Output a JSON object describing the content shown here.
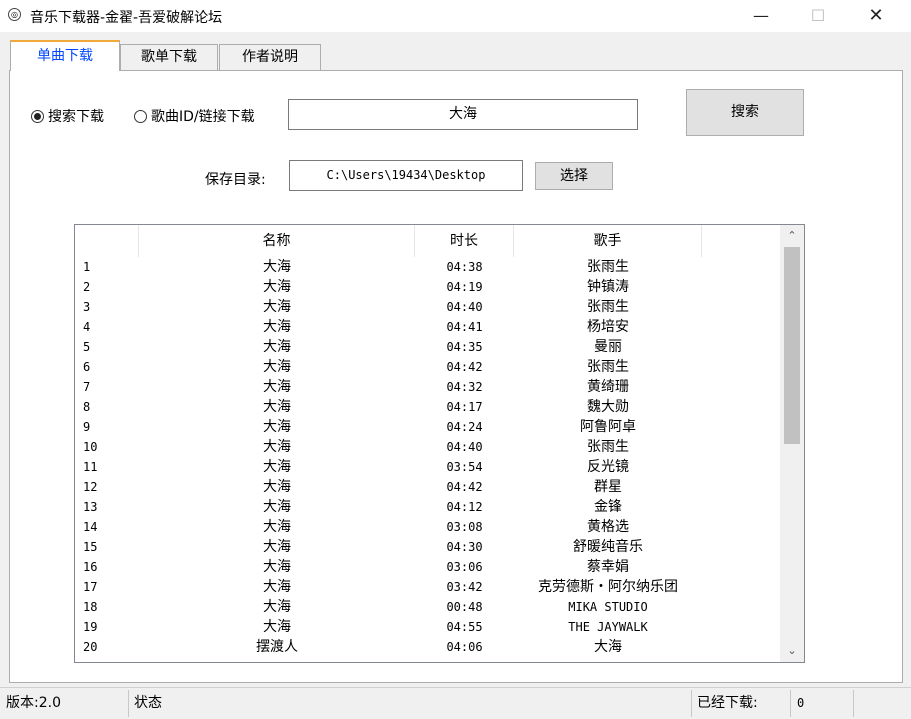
{
  "window": {
    "title": "音乐下载器-金翟-吾爱破解论坛",
    "icon_glyph": "◎"
  },
  "window_controls": {
    "minimize": "—",
    "maximize": "☐",
    "close": "✕"
  },
  "tabs": [
    {
      "label": "单曲下载",
      "active": true
    },
    {
      "label": "歌单下载",
      "active": false
    },
    {
      "label": "作者说明",
      "active": false
    }
  ],
  "mode": {
    "search_label": "搜索下载",
    "id_label": "歌曲ID/链接下载",
    "selected": "search"
  },
  "search": {
    "value": "大海",
    "button_label": "搜索"
  },
  "save": {
    "label": "保存目录:",
    "path": "C:\\Users\\19434\\Desktop",
    "choose_label": "选择"
  },
  "list": {
    "columns": [
      "名称",
      "时长",
      "歌手"
    ],
    "rows": [
      {
        "idx": "1",
        "name": "大海",
        "duration": "04:38",
        "artist": "张雨生"
      },
      {
        "idx": "2",
        "name": "大海",
        "duration": "04:19",
        "artist": "钟镇涛"
      },
      {
        "idx": "3",
        "name": "大海",
        "duration": "04:40",
        "artist": "张雨生"
      },
      {
        "idx": "4",
        "name": "大海",
        "duration": "04:41",
        "artist": "杨培安"
      },
      {
        "idx": "5",
        "name": "大海",
        "duration": "04:35",
        "artist": "曼丽"
      },
      {
        "idx": "6",
        "name": "大海",
        "duration": "04:42",
        "artist": "张雨生"
      },
      {
        "idx": "7",
        "name": "大海",
        "duration": "04:32",
        "artist": "黄绮珊"
      },
      {
        "idx": "8",
        "name": "大海",
        "duration": "04:17",
        "artist": "魏大勋"
      },
      {
        "idx": "9",
        "name": "大海",
        "duration": "04:24",
        "artist": "阿鲁阿卓"
      },
      {
        "idx": "10",
        "name": "大海",
        "duration": "04:40",
        "artist": "张雨生"
      },
      {
        "idx": "11",
        "name": "大海",
        "duration": "03:54",
        "artist": "反光镜"
      },
      {
        "idx": "12",
        "name": "大海",
        "duration": "04:42",
        "artist": "群星"
      },
      {
        "idx": "13",
        "name": "大海",
        "duration": "04:12",
        "artist": "金锋"
      },
      {
        "idx": "14",
        "name": "大海",
        "duration": "03:08",
        "artist": "黄格选"
      },
      {
        "idx": "15",
        "name": "大海",
        "duration": "04:30",
        "artist": "舒暖纯音乐"
      },
      {
        "idx": "16",
        "name": "大海",
        "duration": "03:06",
        "artist": "蔡幸娟"
      },
      {
        "idx": "17",
        "name": "大海",
        "duration": "03:42",
        "artist": "克劳德斯・阿尔纳乐团"
      },
      {
        "idx": "18",
        "name": "大海",
        "duration": "00:48",
        "artist": "MIKA STUDIO"
      },
      {
        "idx": "19",
        "name": "大海",
        "duration": "04:55",
        "artist": "THE JAYWALK"
      },
      {
        "idx": "20",
        "name": "摆渡人",
        "duration": "04:06",
        "artist": "大海"
      }
    ],
    "scroll_up": "⌃",
    "scroll_down": "⌄"
  },
  "status_bar": {
    "version": "版本:2.0",
    "status": "状态",
    "downloaded_label": "已经下载:",
    "downloaded_count": "0"
  }
}
